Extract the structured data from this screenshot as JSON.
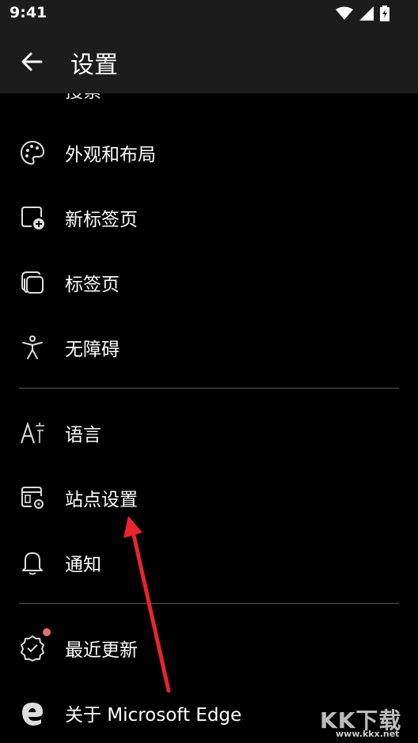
{
  "status": {
    "time": "9:41"
  },
  "header": {
    "title": "设置"
  },
  "partial_item": {
    "label": "搜索"
  },
  "items": [
    {
      "label": "外观和布局",
      "icon": "palette-icon"
    },
    {
      "label": "新标签页",
      "icon": "new-tab-icon"
    },
    {
      "label": "标签页",
      "icon": "tabs-icon"
    },
    {
      "label": "无障碍",
      "icon": "accessibility-icon"
    },
    {
      "label": "语言",
      "icon": "language-icon"
    },
    {
      "label": "站点设置",
      "icon": "site-settings-icon"
    },
    {
      "label": "通知",
      "icon": "bell-icon"
    },
    {
      "label": "最近更新",
      "icon": "badge-check-icon"
    },
    {
      "label": "关于 Microsoft Edge",
      "icon": "edge-logo-icon"
    }
  ],
  "watermark": {
    "text": "KK下载",
    "url": "www.kkx.net"
  },
  "colors": {
    "background": "#000000",
    "appbar": "#1c1c1c",
    "arrow": "#e8252c",
    "badge": "#e46f6f"
  }
}
